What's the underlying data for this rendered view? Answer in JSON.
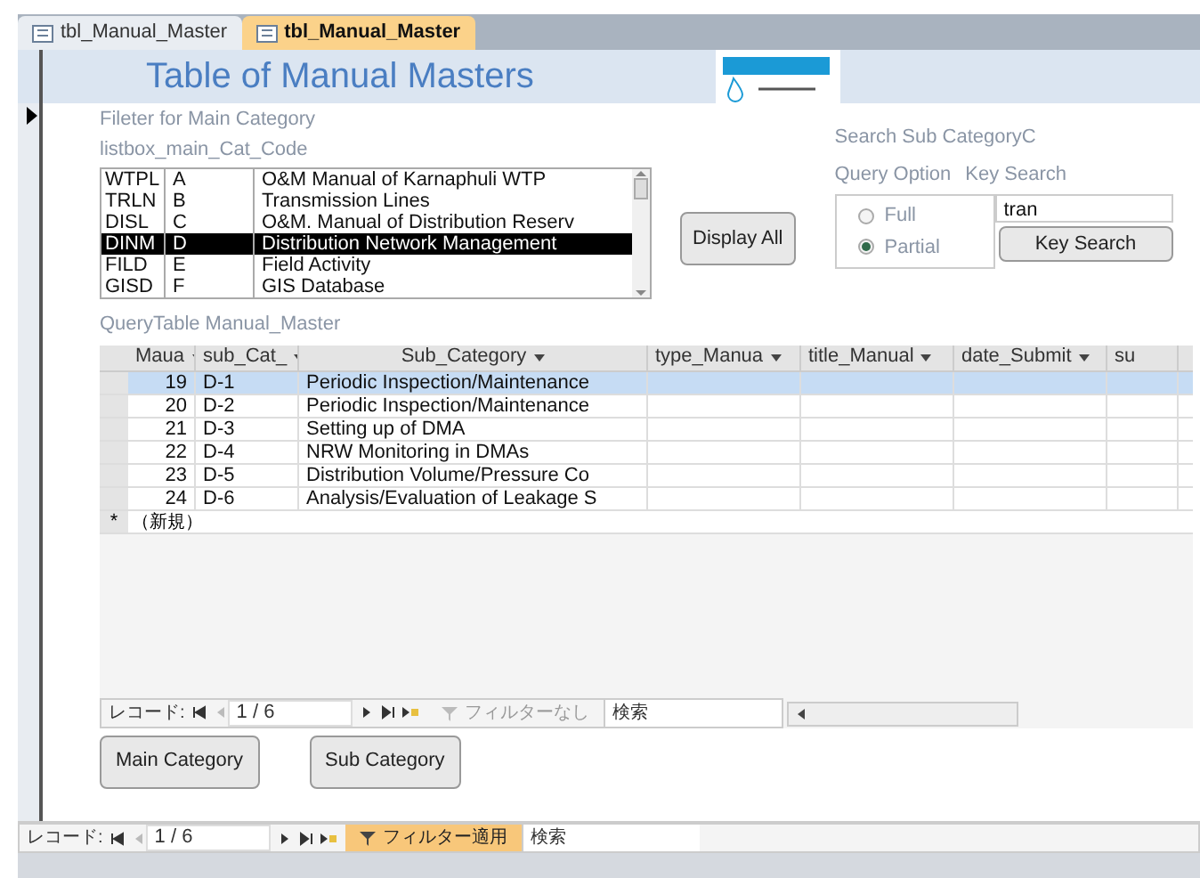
{
  "tabs": [
    {
      "label": "tbl_Manual_Master",
      "selected": false
    },
    {
      "label": "tbl_Manual_Master",
      "selected": true
    }
  ],
  "form": {
    "title": "Table of Manual Masters",
    "filter_label": "Fileter for Main Category",
    "listbox_label": "listbox_main_Cat_Code",
    "listbox": [
      {
        "code": "WTPL",
        "letter": "A",
        "name": "O&M Manual of Karnaphuli WTP",
        "selected": false
      },
      {
        "code": "TRLN",
        "letter": "B",
        "name": "Transmission Lines",
        "selected": false
      },
      {
        "code": "DISL",
        "letter": "C",
        "name": "O&M. Manual of Distribution Reserv",
        "selected": false
      },
      {
        "code": "DINM",
        "letter": "D",
        "name": "Distribution Network Management",
        "selected": true
      },
      {
        "code": "FILD",
        "letter": "E",
        "name": "Field Activity",
        "selected": false
      },
      {
        "code": "GISD",
        "letter": "F",
        "name": "GIS Database",
        "selected": false
      }
    ],
    "display_all": "Display All",
    "search_title": "Search Sub CategoryC",
    "query_option_label": "Query Option",
    "key_search_label": "Key Search",
    "options": [
      {
        "label": "Full",
        "selected": false
      },
      {
        "label": "Partial",
        "selected": true
      }
    ],
    "key_value": "tran",
    "key_search_button": "Key Search",
    "query_label": "QueryTable Manual_Master",
    "table": {
      "columns": [
        "Maua",
        "sub_Cat_",
        "Sub_Category",
        "type_Manua",
        "title_Manual",
        "date_Submit",
        "su"
      ],
      "rows": [
        {
          "cells": [
            "19",
            "D-1",
            "Periodic Inspection/Maintenance"
          ],
          "selected": true
        },
        {
          "cells": [
            "20",
            "D-2",
            "Periodic Inspection/Maintenance"
          ],
          "selected": false
        },
        {
          "cells": [
            "21",
            "D-3",
            "Setting up of DMA"
          ],
          "selected": false
        },
        {
          "cells": [
            "22",
            "D-4",
            "NRW Monitoring in DMAs"
          ],
          "selected": false
        },
        {
          "cells": [
            "23",
            "D-5",
            "Distribution Volume/Pressure Co"
          ],
          "selected": false
        },
        {
          "cells": [
            "24",
            "D-6",
            "Analysis/Evaluation of Leakage S"
          ],
          "selected": false
        }
      ],
      "new_row_marker": "*",
      "new_row_label": "（新規）"
    },
    "subnav": {
      "label": "レコード:",
      "position": "1 / 6",
      "filter": "フィルターなし",
      "filter_active": false,
      "search": "検索"
    },
    "buttons": [
      "Main Category",
      "Sub Category"
    ]
  },
  "navigation": {
    "label": "レコード:",
    "position": "1 / 6",
    "filter": "フィルター適用",
    "filter_active": true,
    "search": "検索"
  }
}
